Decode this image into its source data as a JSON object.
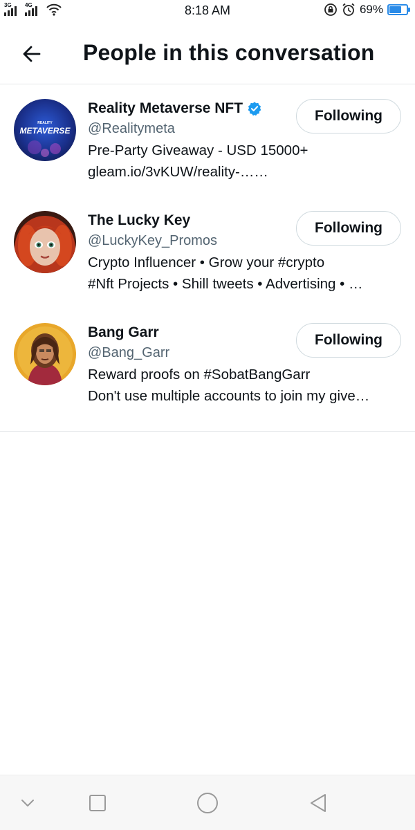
{
  "status_bar": {
    "network_1": "3G",
    "network_2": "4G",
    "time": "8:18 AM",
    "battery_percent_label": "69%",
    "battery_level": 0.69
  },
  "header": {
    "title": "People in this conversation",
    "back_icon": "arrow-left-icon"
  },
  "people": [
    {
      "name": "Reality Metaverse NFT",
      "verified": true,
      "handle": "@Realitymeta",
      "bio_line1": "Pre-Party Giveaway - USD 15000+",
      "bio_line2": "gleam.io/3vKUW/reality-……",
      "button_label": "Following",
      "avatar_text_small": "REALITY",
      "avatar_text_big": "METAVERSE"
    },
    {
      "name": "The Lucky Key",
      "verified": false,
      "handle": "@LuckyKey_Promos",
      "bio_line1": "Crypto Influencer • Grow your #crypto",
      "bio_line2": "#Nft Projects • Shill tweets • Advertising • …",
      "button_label": "Following"
    },
    {
      "name": "Bang Garr",
      "verified": false,
      "handle": "@Bang_Garr",
      "bio_line1": "Reward proofs on #SobatBangGarr",
      "bio_line2": "Don't use multiple accounts to join my give…",
      "button_label": "Following"
    }
  ],
  "nav_bar": {
    "icons": [
      "chevron-down-icon",
      "square-recents-icon",
      "circle-home-icon",
      "triangle-back-icon"
    ]
  },
  "colors": {
    "verified_blue": "#1d9bf0",
    "handle_gray": "#536471",
    "border": "#cfd9de",
    "battery_blue": "#2a8be8"
  }
}
